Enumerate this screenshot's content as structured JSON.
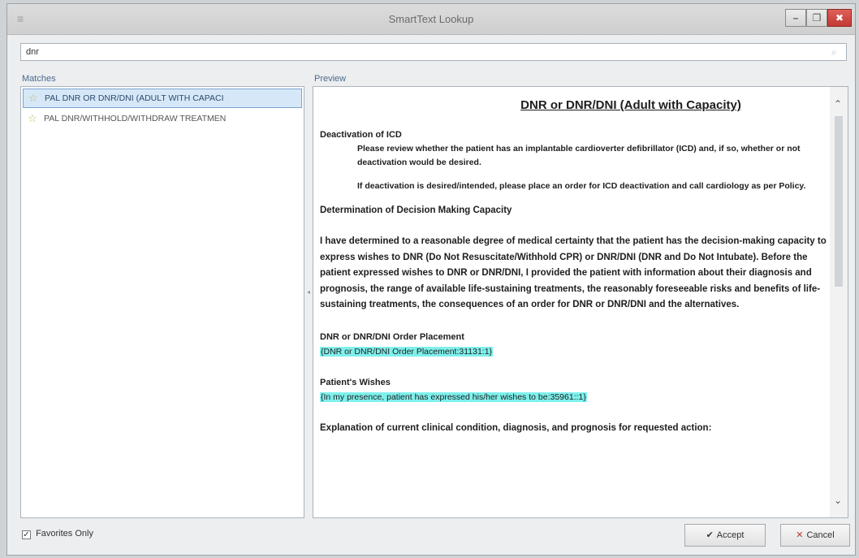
{
  "window": {
    "title": "SmartText Lookup",
    "min_glyph": "–",
    "max_glyph": "❐",
    "close_glyph": "✖"
  },
  "search": {
    "value": "dnr"
  },
  "matches": {
    "label": "Matches",
    "items": [
      {
        "label": "PAL DNR OR DNR/DNI (ADULT WITH CAPACI",
        "selected": true,
        "icon": "star-icon"
      },
      {
        "label": "PAL DNR/WITHHOLD/WITHDRAW TREATMEN",
        "selected": false,
        "icon": "star-icon"
      }
    ]
  },
  "preview": {
    "label": "Preview",
    "title": "DNR or DNR/DNI (Adult with Capacity)",
    "deactivation_heading": "Deactivation of ICD",
    "deactivation_p1": "Please review whether the patient has an implantable cardioverter defibrillator (ICD) and, if so, whether or not deactivation would be desired.",
    "deactivation_p2": "If deactivation is desired/intended, please place an order for ICD deactivation and call cardiology as per Policy.",
    "capacity_heading": "Determination of Decision Making Capacity",
    "capacity_para": "I have determined to a reasonable degree of medical certainty that the patient has the decision-making capacity to express wishes to DNR (Do Not Resuscitate/Withhold CPR) or DNR/DNI (DNR and Do Not Intubate). Before the patient expressed wishes to DNR or DNR/DNI, I provided the patient with information about their diagnosis and prognosis, the range of available life-sustaining treatments, the reasonably foreseeable risks and benefits of life-sustaining treatments, the consequences of an order for DNR or DNR/DNI and the alternatives.",
    "order_heading": "DNR or DNR/DNI Order Placement",
    "order_field": "{DNR or DNR/DNI Order Placement:31131:1}",
    "wishes_heading": "Patient's Wishes",
    "wishes_field": "{In my presence, patient has expressed his/her wishes to be:35961::1}",
    "explanation_heading": "Explanation of current clinical condition, diagnosis, and prognosis for requested action:"
  },
  "footer": {
    "favorites_label": "Favorites Only",
    "favorites_checked": true,
    "accept_label": "Accept",
    "cancel_label": "Cancel"
  }
}
